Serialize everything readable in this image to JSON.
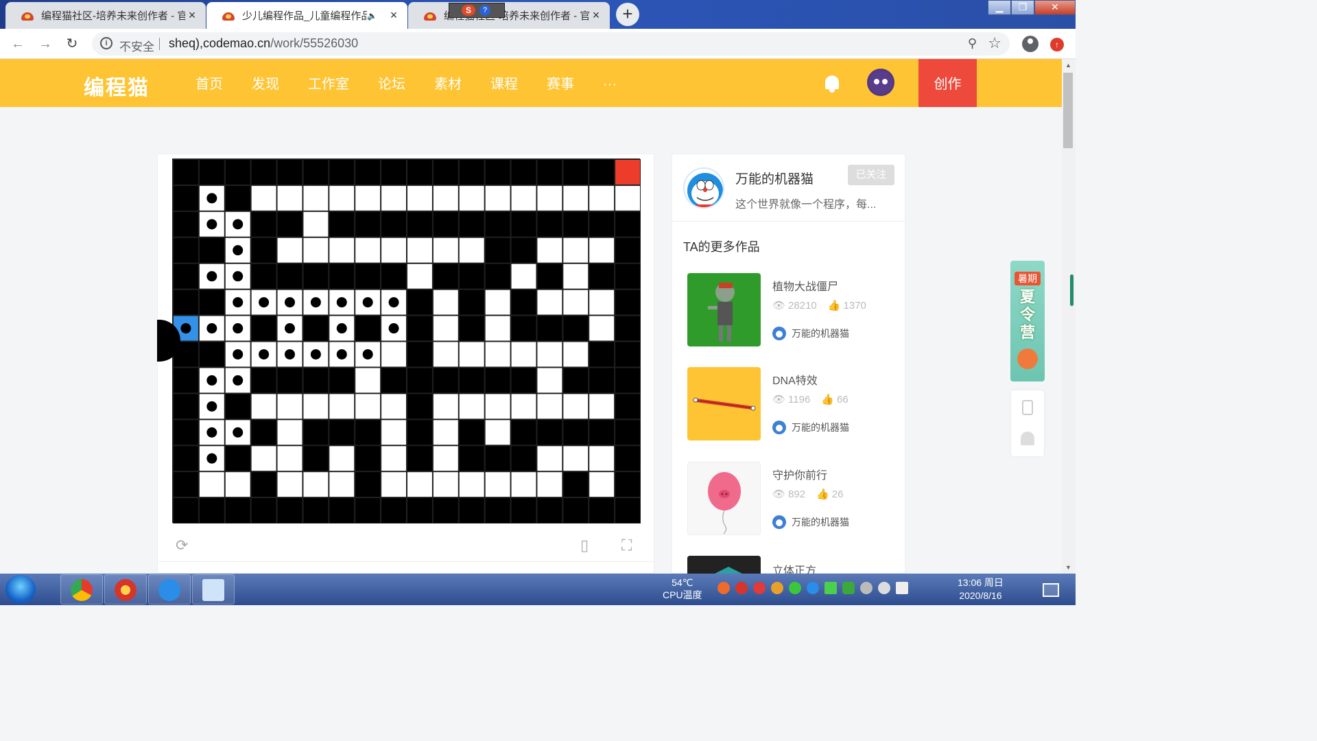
{
  "browser": {
    "tabs": [
      {
        "title": "编程猫社区-培养未来创作者 - 官",
        "active": false
      },
      {
        "title": "少儿编程作品_儿童编程作品",
        "active": true
      },
      {
        "title": "编程猫社区-培养未来创作者 - 官",
        "active": false
      }
    ],
    "address": {
      "security": "不安全",
      "host": "sheq),codemao.cn",
      "path": "/work/55526030"
    }
  },
  "site": {
    "logo": "编程猫",
    "nav": [
      "首页",
      "发现",
      "工作室",
      "论坛",
      "素材",
      "课程",
      "赛事",
      "···"
    ],
    "create_label": "创作"
  },
  "work_stage": {
    "grid_cols": 18,
    "grid_rows": 14,
    "rows": [
      "BBBBBBBBBBBBBBBBBR",
      "BDBWWWWWWWWWWWWWWW",
      "BDDBBWBBBBBBBBBBBB",
      "BBDBWWWWWWWWBBWWWB",
      "BDDBBBBBBWBBBWBWBB",
      "BBDDDDDDDBWBWBWWWB",
      "PDDBDBDBDBWBWBBBWB",
      "BBDDDDDDWBWWWWWWBB",
      "BDDBBBBWBBBBBBWBBB",
      "BDBWWWWWWBWWWWWWWB",
      "BDDBWBBBWBWBWBBBBB",
      "BDBWWBWBWBWBBBWWWB",
      "BWWBWWWBWWWWWWWBWB",
      "BBBBBBBBBBBBBBBBBB"
    ]
  },
  "author": {
    "name": "万能的机器猫",
    "bio": "这个世界就像一个程序，每...",
    "follow_label": "已关注"
  },
  "more_works": {
    "title": "TA的更多作品",
    "items": [
      {
        "title": "植物大战僵尸",
        "views": "28210",
        "likes": "1370",
        "author": "万能的机器猫"
      },
      {
        "title": "DNA特效",
        "views": "1196",
        "likes": "66",
        "author": "万能的机器猫"
      },
      {
        "title": "守护你前行",
        "views": "892",
        "likes": "26",
        "author": "万能的机器猫"
      },
      {
        "title": "立体正方",
        "views": "",
        "likes": "",
        "author": ""
      }
    ]
  },
  "promo": {
    "tag": "暑期",
    "text": "夏令营"
  },
  "taskbar": {
    "cpu_temp": "54℃",
    "cpu_label": "CPU温度",
    "time": "13:06 周日",
    "date": "2020/8/16"
  },
  "colors": {
    "header_yellow": "#fec433",
    "create_red": "#ee4a3c",
    "goal_red": "#ee3c2b",
    "player_blue": "#3391e8"
  }
}
